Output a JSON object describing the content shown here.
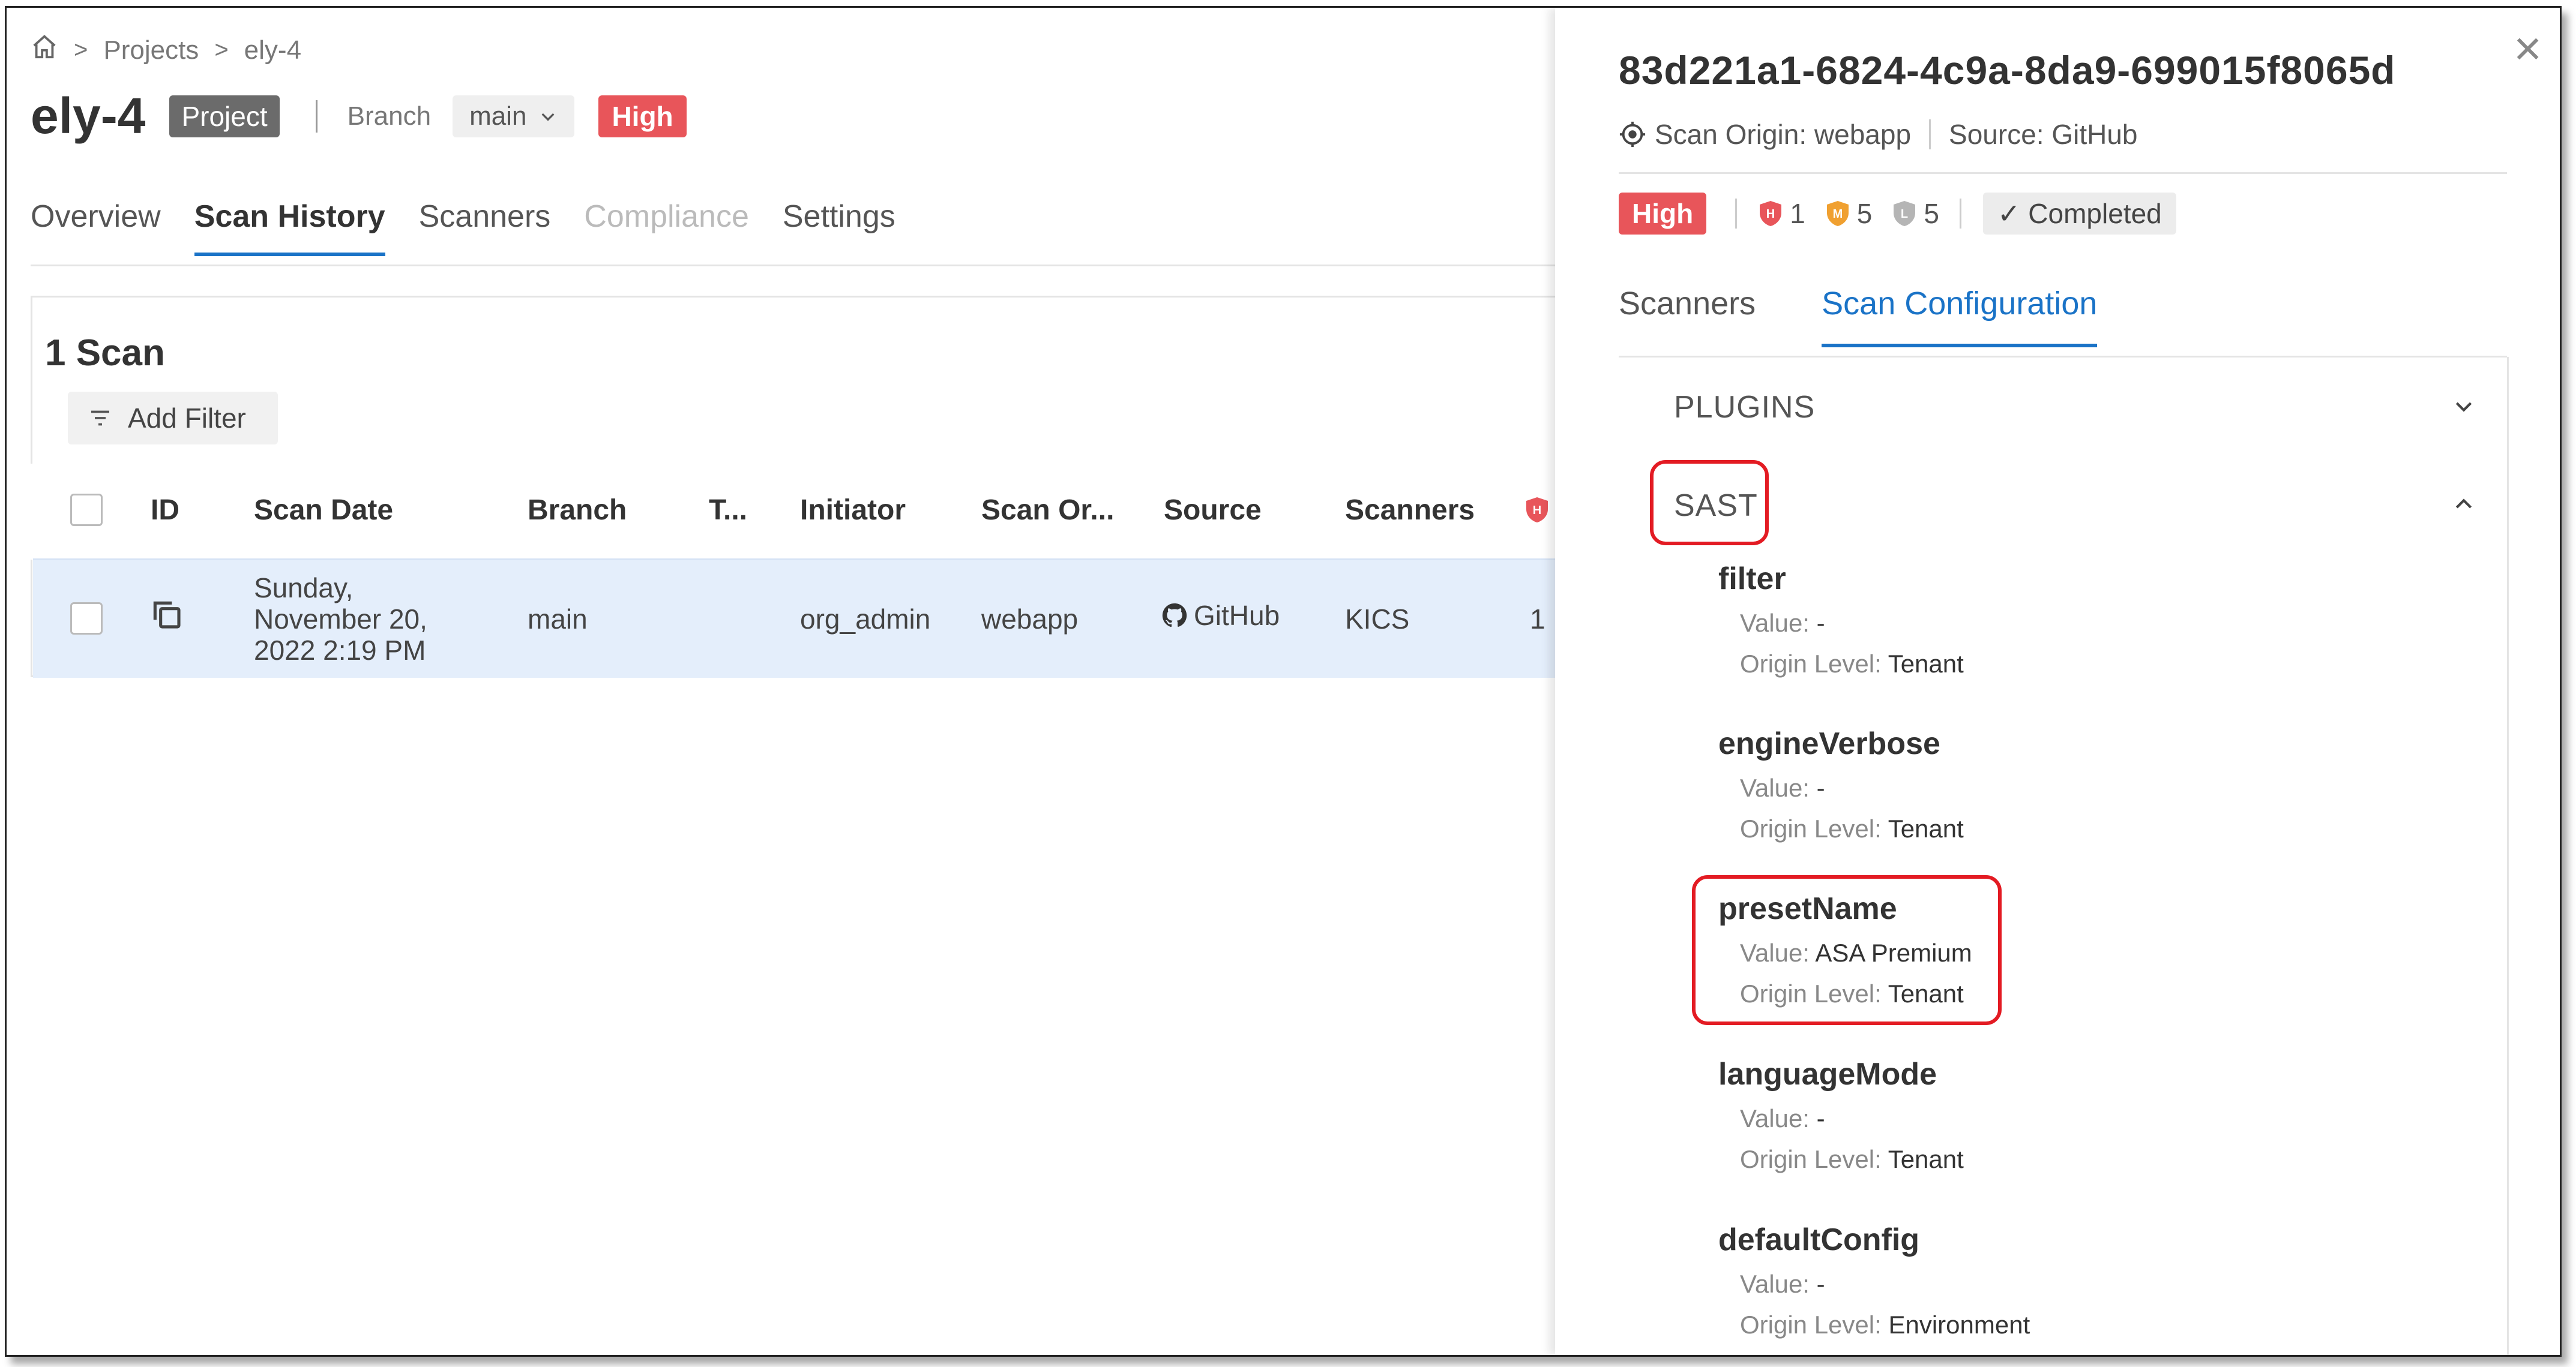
{
  "breadcrumb": {
    "home_icon": "home-icon",
    "projects": "Projects",
    "project": "ely-4",
    "separator": ">"
  },
  "project": {
    "name": "ely-4",
    "type_badge": "Project",
    "branch_label": "Branch",
    "branch_value": "main",
    "risk_badge": "High"
  },
  "tabs": [
    {
      "label": "Overview"
    },
    {
      "label": "Scan History"
    },
    {
      "label": "Scanners"
    },
    {
      "label": "Compliance"
    },
    {
      "label": "Settings"
    }
  ],
  "scans": {
    "count_label": "1 Scan",
    "add_filter": "Add Filter",
    "columns": [
      "ID",
      "Scan Date",
      "Branch",
      "T...",
      "Initiator",
      "Scan Or...",
      "Source",
      "Scanners"
    ],
    "row": {
      "date_line1": "Sunday,",
      "date_line2": "November 20,",
      "date_line3": "2022 2:19 PM",
      "branch": "main",
      "initiator": "org_admin",
      "origin": "webapp",
      "source": "GitHub",
      "scanners": "KICS",
      "high_count": "1"
    }
  },
  "panel": {
    "close": "×",
    "scan_id": "83d221a1-6824-4c9a-8da9-699015f8065d",
    "scan_origin": "Scan Origin: webapp",
    "source": "Source: GitHub",
    "risk": "High",
    "high": "1",
    "medium": "5",
    "low": "5",
    "status": "✓ Completed",
    "tabs": [
      {
        "label": "Scanners"
      },
      {
        "label": "Scan Configuration"
      }
    ],
    "sections": {
      "plugins": "PLUGINS",
      "sast": "SAST"
    },
    "value_label": "Value:",
    "origin_label": "Origin Level:",
    "params": [
      {
        "name": "filter",
        "value": "-",
        "origin": "Tenant"
      },
      {
        "name": "engineVerbose",
        "value": "-",
        "origin": "Tenant"
      },
      {
        "name": "presetName",
        "value": "ASA Premium",
        "origin": "Tenant"
      },
      {
        "name": "languageMode",
        "value": "-",
        "origin": "Tenant"
      },
      {
        "name": "defaultConfig",
        "value": "-",
        "origin": "Environment"
      }
    ]
  },
  "colors": {
    "accent": "#1a73c7",
    "high": "#e8555a",
    "medium": "#f0a030",
    "low": "#b5b5b5",
    "highlight": "#e31b23"
  }
}
